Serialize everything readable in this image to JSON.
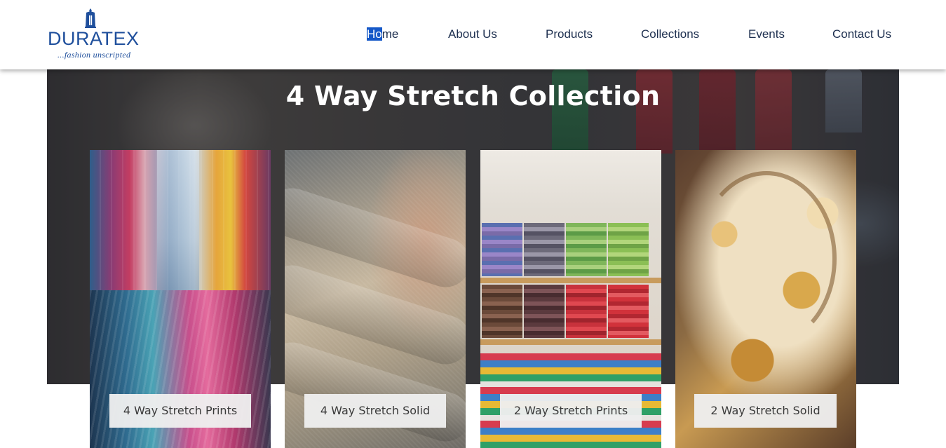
{
  "brand": {
    "name": "DURATEX",
    "tagline": "...fashion unscripted",
    "color": "#1f4f9c"
  },
  "nav": {
    "items": [
      {
        "label": "Home",
        "active": true
      },
      {
        "label": "About Us"
      },
      {
        "label": "Products"
      },
      {
        "label": "Collections"
      },
      {
        "label": "Events"
      },
      {
        "label": "Contact Us"
      }
    ],
    "active_highlight_color": "#1558c8"
  },
  "hero": {
    "title": "4 Way Stretch Collection"
  },
  "collections": [
    {
      "label": "4 Way Stretch Prints",
      "image": "textile-factory-threads"
    },
    {
      "label": "4 Way Stretch Solid",
      "image": "beige-fabric-rolls"
    },
    {
      "label": "2 Way Stretch Prints",
      "image": "fabric-shelf"
    },
    {
      "label": "2 Way Stretch Solid",
      "image": "gold-paisley-fabric"
    }
  ]
}
